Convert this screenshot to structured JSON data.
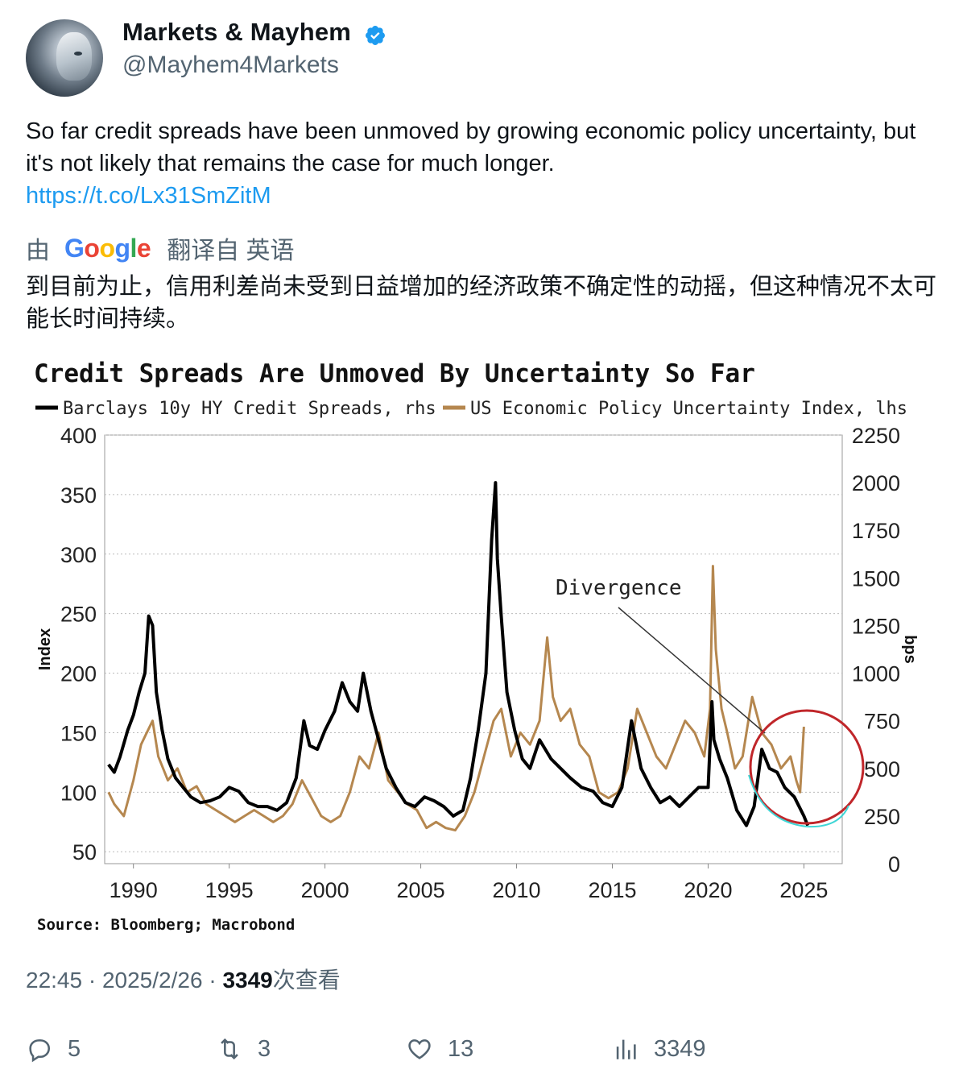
{
  "author": {
    "name": "Markets & Mayhem",
    "handle": "@Mayhem4Markets",
    "verified_color": "#1d9bf0"
  },
  "tweet": {
    "text": "So far credit spreads have been unmoved by growing economic policy uncertainty, but it's not likely that remains the case for much longer.",
    "link": "https://t.co/Lx31SmZitM"
  },
  "translation": {
    "prefix": "由",
    "provider": "Google",
    "suffix": "翻译自 英语",
    "text": "到目前为止，信用利差尚未受到日益增加的经济政策不确定性的动摇，但这种情况不太可能长时间持续。"
  },
  "chart_data": {
    "type": "line",
    "title": "Credit Spreads Are Unmoved By Uncertainty So Far",
    "legend": [
      {
        "name": "Barclays 10y HY Credit Spreads, rhs",
        "color": "#000000"
      },
      {
        "name": "US Economic Policy Uncertainty Index, lhs",
        "color": "#b5874f"
      }
    ],
    "ylabel_left": "Index",
    "ylabel_right": "bps",
    "ylim_left": [
      40,
      400
    ],
    "ylim_right": [
      0,
      2250
    ],
    "yticks_left": [
      "400",
      "350",
      "300",
      "250",
      "200",
      "150",
      "100",
      "50"
    ],
    "yticks_right": [
      "2250",
      "2000",
      "1750",
      "1500",
      "1250",
      "1000",
      "750",
      "500",
      "250",
      "0"
    ],
    "xticks": [
      "1990",
      "1995",
      "2000",
      "2005",
      "2010",
      "2015",
      "2020",
      "2025"
    ],
    "xlim": [
      1988.5,
      2027
    ],
    "annotation": "Divergence",
    "source": "Source: Bloomberg; Macrobond",
    "grid": true,
    "series": [
      {
        "name": "Barclays 10y HY Credit Spreads, rhs",
        "axis": "right",
        "x": [
          1988.7,
          1989.0,
          1989.3,
          1989.7,
          1990.0,
          1990.3,
          1990.6,
          1990.8,
          1991.0,
          1991.2,
          1991.5,
          1991.8,
          1992.2,
          1992.6,
          1993.0,
          1993.5,
          1994.0,
          1994.5,
          1995.0,
          1995.5,
          1996.0,
          1996.5,
          1997.0,
          1997.5,
          1998.0,
          1998.5,
          1998.9,
          1999.2,
          1999.6,
          2000.0,
          2000.5,
          2000.9,
          2001.3,
          2001.7,
          2002.0,
          2002.4,
          2002.8,
          2003.2,
          2003.7,
          2004.2,
          2004.7,
          2005.2,
          2005.7,
          2006.2,
          2006.7,
          2007.2,
          2007.6,
          2008.0,
          2008.4,
          2008.7,
          2008.9,
          2009.0,
          2009.2,
          2009.5,
          2009.9,
          2010.3,
          2010.7,
          2011.2,
          2011.8,
          2012.3,
          2012.8,
          2013.4,
          2014.0,
          2014.5,
          2015.0,
          2015.5,
          2016.0,
          2016.5,
          2017.0,
          2017.5,
          2018.0,
          2018.5,
          2019.0,
          2019.5,
          2020.0,
          2020.2,
          2020.3,
          2020.6,
          2021.0,
          2021.5,
          2022.0,
          2022.4,
          2022.8,
          2023.2,
          2023.6,
          2024.0,
          2024.5,
          2025.0,
          2025.2
        ],
        "values": [
          520,
          480,
          560,
          700,
          780,
          900,
          1000,
          1300,
          1250,
          900,
          700,
          550,
          450,
          400,
          350,
          320,
          330,
          350,
          400,
          380,
          320,
          300,
          300,
          280,
          320,
          450,
          750,
          620,
          600,
          700,
          800,
          950,
          850,
          800,
          1000,
          800,
          650,
          500,
          400,
          320,
          300,
          350,
          330,
          300,
          250,
          280,
          450,
          700,
          1000,
          1700,
          2000,
          1600,
          1300,
          900,
          700,
          550,
          500,
          650,
          550,
          500,
          450,
          400,
          380,
          320,
          300,
          400,
          750,
          500,
          400,
          320,
          350,
          300,
          350,
          400,
          400,
          850,
          650,
          550,
          450,
          280,
          200,
          300,
          600,
          500,
          480,
          400,
          350,
          250,
          200
        ]
      },
      {
        "name": "US Economic Policy Uncertainty Index, lhs",
        "axis": "left",
        "x": [
          1988.7,
          1989.0,
          1989.5,
          1990.0,
          1990.4,
          1990.7,
          1991.0,
          1991.3,
          1991.8,
          1992.3,
          1992.8,
          1993.3,
          1993.8,
          1994.3,
          1994.8,
          1995.3,
          1995.8,
          1996.3,
          1996.8,
          1997.3,
          1997.8,
          1998.3,
          1998.8,
          1999.3,
          1999.8,
          2000.3,
          2000.8,
          2001.3,
          2001.8,
          2002.3,
          2002.8,
          2003.3,
          2003.8,
          2004.3,
          2004.8,
          2005.3,
          2005.8,
          2006.3,
          2006.8,
          2007.3,
          2007.8,
          2008.3,
          2008.8,
          2009.2,
          2009.7,
          2010.2,
          2010.7,
          2011.2,
          2011.6,
          2011.9,
          2012.3,
          2012.8,
          2013.3,
          2013.8,
          2014.3,
          2014.8,
          2015.3,
          2015.8,
          2016.3,
          2016.8,
          2017.3,
          2017.8,
          2018.3,
          2018.8,
          2019.3,
          2019.8,
          2020.1,
          2020.25,
          2020.4,
          2020.7,
          2021.0,
          2021.4,
          2021.8,
          2022.3,
          2022.8,
          2023.3,
          2023.8,
          2024.3,
          2024.6,
          2024.8,
          2025.0
        ],
        "values": [
          100,
          90,
          80,
          110,
          140,
          150,
          160,
          130,
          110,
          120,
          100,
          105,
          90,
          85,
          80,
          75,
          80,
          85,
          80,
          75,
          80,
          90,
          110,
          95,
          80,
          75,
          80,
          100,
          130,
          120,
          150,
          110,
          100,
          90,
          85,
          70,
          75,
          70,
          68,
          80,
          100,
          130,
          160,
          170,
          130,
          150,
          140,
          160,
          230,
          180,
          160,
          170,
          140,
          130,
          100,
          95,
          100,
          120,
          170,
          150,
          130,
          120,
          140,
          160,
          150,
          130,
          170,
          290,
          220,
          170,
          150,
          120,
          130,
          180,
          150,
          140,
          120,
          130,
          110,
          100,
          155
        ]
      }
    ]
  },
  "meta": {
    "time": "22:45",
    "date": "2025/2/26",
    "sep": "·",
    "views": "3349",
    "views_label": "次查看"
  },
  "actions": {
    "replies": "5",
    "retweets": "3",
    "likes": "13",
    "views": "3349"
  }
}
